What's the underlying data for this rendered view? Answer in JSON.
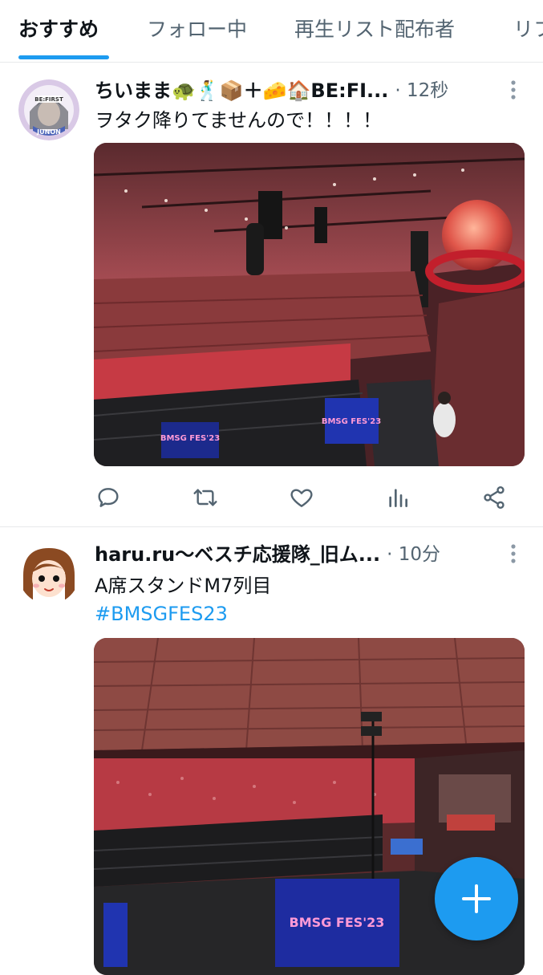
{
  "tabs": [
    {
      "label": "おすすめ",
      "active": true
    },
    {
      "label": "フォロー中",
      "active": false
    },
    {
      "label": "再生リスト配布者",
      "active": false
    },
    {
      "label": "リフ",
      "active": false
    }
  ],
  "colors": {
    "accent": "#1d9bf0",
    "text": "#0f1419",
    "muted": "#536471",
    "divider": "#e7e9ea"
  },
  "posts": [
    {
      "name": "ちいまま🐢🕺📦＋🧀🏠BE:FI...",
      "time": "· 12秒",
      "text": "ヲタク降りてませんので！！！！",
      "avatar_badge_text": "JUNON",
      "media": {
        "screen_text_1": "BMSG FES'23",
        "screen_text_2": "BMSG FES'23"
      }
    },
    {
      "name": "haru.ru〜ベスチ応援隊_旧ム...",
      "time": "· 10分",
      "text": "A席スタンドM7列目",
      "hashtag": "#BMSGFES23",
      "media": {
        "screen_text": "BMSG FES'23"
      }
    }
  ],
  "actions": [
    "reply-icon",
    "repost-icon",
    "like-icon",
    "views-icon",
    "share-icon"
  ],
  "fab": {
    "icon": "plus-icon"
  }
}
